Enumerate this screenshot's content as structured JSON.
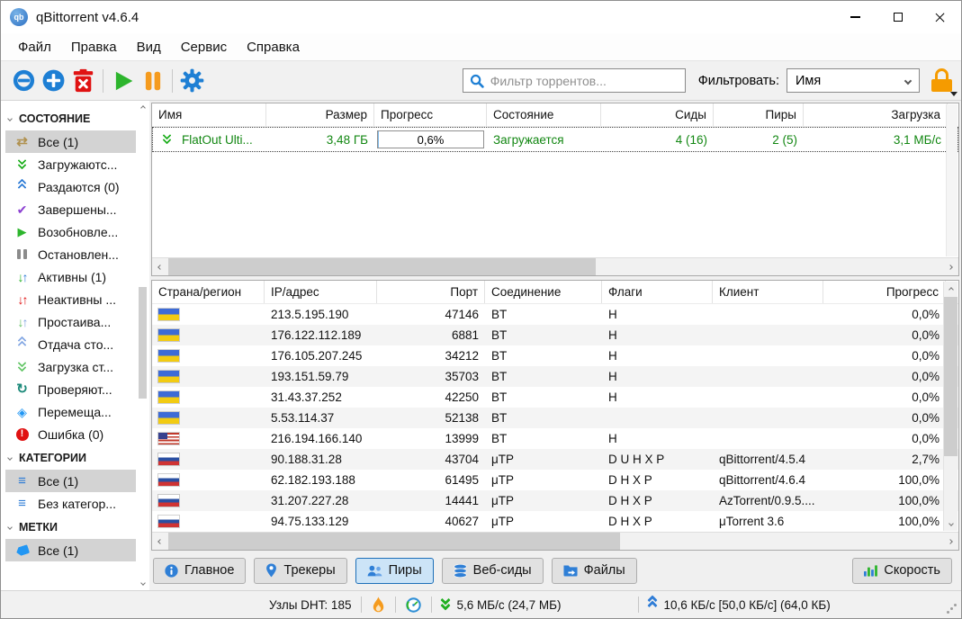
{
  "window": {
    "title": "qBittorrent v4.6.4",
    "logo_text": "qb"
  },
  "menu": {
    "items": [
      "Файл",
      "Правка",
      "Вид",
      "Сервис",
      "Справка"
    ]
  },
  "toolbar": {
    "buttons": [
      "add-link-icon",
      "add-torrent-icon",
      "delete-icon",
      "resume-icon",
      "pause-icon",
      "options-gear-icon"
    ],
    "filter_placeholder": "Фильтр торрентов...",
    "filter_label": "Фильтровать:",
    "filter_value": "Имя",
    "lock_icon": "lock-icon"
  },
  "colors": {
    "accent_blue": "#1e7fd4",
    "green": "#2db52d",
    "orange": "#f59b1e",
    "red": "#e01212",
    "torrent_text_green": "#128712",
    "tab_active_bg": "#cce4f7",
    "selected_gray": "#d3d3d3"
  },
  "sidebar": {
    "sections": [
      {
        "title": "СОСТОЯНИЕ",
        "items": [
          {
            "id": "all",
            "icon": "shuffle-icon",
            "label": "Все (1)",
            "selected": true
          },
          {
            "id": "downloading",
            "icon": "double-chevron-down-green-icon",
            "label": "Загружаютс...",
            "selected": false
          },
          {
            "id": "seeding",
            "icon": "double-chevron-up-blue-icon",
            "label": "Раздаются (0)",
            "selected": false
          },
          {
            "id": "completed",
            "icon": "checkmark-purple-icon",
            "label": "Завершены...",
            "selected": false
          },
          {
            "id": "resumed",
            "icon": "play-green-icon",
            "label": "Возобновле...",
            "selected": false
          },
          {
            "id": "stopped",
            "icon": "pause-gray-icon",
            "label": "Остановлен...",
            "selected": false
          },
          {
            "id": "active",
            "icon": "arrows-down-up-icon",
            "label": "Активны (1)",
            "selected": false
          },
          {
            "id": "inactive",
            "icon": "arrows-down-up-red-icon",
            "label": "Неактивны ...",
            "selected": false
          },
          {
            "id": "stalled",
            "icon": "arrows-down-up-light-icon",
            "label": "Простаива...",
            "selected": false
          },
          {
            "id": "stalled-uploading",
            "icon": "double-chevron-up-lightblue-icon",
            "label": "Отдача сто...",
            "selected": false
          },
          {
            "id": "stalled-downloading",
            "icon": "double-chevron-down-lightgreen-icon",
            "label": "Загрузка ст...",
            "selected": false
          },
          {
            "id": "checking",
            "icon": "refresh-teal-icon",
            "label": "Проверяют...",
            "selected": false
          },
          {
            "id": "moving",
            "icon": "move-diamond-blue-icon",
            "label": "Перемеща...",
            "selected": false
          },
          {
            "id": "errored",
            "icon": "error-red-icon",
            "label": "Ошибка (0)",
            "selected": false
          }
        ]
      },
      {
        "title": "КАТЕГОРИИ",
        "items": [
          {
            "id": "cat-all",
            "icon": "category-list-icon",
            "label": "Все (1)",
            "selected": true
          },
          {
            "id": "cat-uncategorized",
            "icon": "category-list-icon",
            "label": "Без категор...",
            "selected": false
          }
        ]
      },
      {
        "title": "МЕТКИ",
        "items": [
          {
            "id": "tag-all",
            "icon": "tag-blue-icon",
            "label": "Все (1)",
            "selected": true
          }
        ]
      }
    ]
  },
  "torrents": {
    "columns": [
      "Имя",
      "Размер",
      "Прогресс",
      "Состояние",
      "Сиды",
      "Пиры",
      "Загрузка"
    ],
    "rows": [
      {
        "name": "FlatOut Ulti...",
        "size": "3,48 ГБ",
        "progress": "0,6%",
        "state": "Загружается",
        "seeds": "4 (16)",
        "peers": "2 (5)",
        "down_speed": "3,1 МБ/с",
        "icon": "double-chevron-down-green-icon"
      }
    ]
  },
  "peers": {
    "columns": [
      "Страна/регион",
      "IP/адрес",
      "Порт",
      "Соединение",
      "Флаги",
      "Клиент",
      "Прогресс"
    ],
    "sorted_column": "Страна/регион",
    "rows": [
      {
        "flag": "ua",
        "ip": "213.5.195.190",
        "port": "47146",
        "conn": "BT",
        "flags": "H",
        "client": "",
        "progress": "0,0%"
      },
      {
        "flag": "ua",
        "ip": "176.122.112.189",
        "port": "6881",
        "conn": "BT",
        "flags": "H",
        "client": "",
        "progress": "0,0%"
      },
      {
        "flag": "ua",
        "ip": "176.105.207.245",
        "port": "34212",
        "conn": "BT",
        "flags": "H",
        "client": "",
        "progress": "0,0%"
      },
      {
        "flag": "ua",
        "ip": "193.151.59.79",
        "port": "35703",
        "conn": "BT",
        "flags": "H",
        "client": "",
        "progress": "0,0%"
      },
      {
        "flag": "ua",
        "ip": "31.43.37.252",
        "port": "42250",
        "conn": "BT",
        "flags": "H",
        "client": "",
        "progress": "0,0%"
      },
      {
        "flag": "ua",
        "ip": "5.53.114.37",
        "port": "52138",
        "conn": "BT",
        "flags": "",
        "client": "",
        "progress": "0,0%"
      },
      {
        "flag": "us",
        "ip": "216.194.166.140",
        "port": "13999",
        "conn": "BT",
        "flags": "H",
        "client": "",
        "progress": "0,0%"
      },
      {
        "flag": "ru",
        "ip": "90.188.31.28",
        "port": "43704",
        "conn": "μTP",
        "flags": "D U H X P",
        "client": "qBittorrent/4.5.4",
        "progress": "2,7%"
      },
      {
        "flag": "ru",
        "ip": "62.182.193.188",
        "port": "61495",
        "conn": "μTP",
        "flags": "D H X P",
        "client": "qBittorrent/4.6.4",
        "progress": "100,0%"
      },
      {
        "flag": "ru",
        "ip": "31.207.227.28",
        "port": "14441",
        "conn": "μTP",
        "flags": "D H X P",
        "client": "AzTorrent/0.9.5....",
        "progress": "100,0%"
      },
      {
        "flag": "ru",
        "ip": "94.75.133.129",
        "port": "40627",
        "conn": "μTP",
        "flags": "D H X P",
        "client": "μTorrent 3.6",
        "progress": "100,0%"
      }
    ]
  },
  "tabs": {
    "items": [
      {
        "id": "general",
        "icon": "info-circle-icon",
        "label": "Главное",
        "active": false
      },
      {
        "id": "trackers",
        "icon": "location-pin-icon",
        "label": "Трекеры",
        "active": false
      },
      {
        "id": "peers",
        "icon": "peers-people-icon",
        "label": "Пиры",
        "active": true
      },
      {
        "id": "webseeds",
        "icon": "stacked-discs-icon",
        "label": "Веб-сиды",
        "active": false
      },
      {
        "id": "files",
        "icon": "folder-arrow-icon",
        "label": "Файлы",
        "active": false
      }
    ],
    "speed_label": "Скорость",
    "speed_icon": "bar-chart-icon"
  },
  "statusbar": {
    "dht": "Узлы DHT: 185",
    "down_speed": "5,6 МБ/с (24,7 МБ)",
    "up_speed": "10,6 КБ/с [50,0 КБ/с] (64,0 КБ)",
    "icons": [
      "speed-limit-flame-icon",
      "alt-speed-gauge-icon",
      "download-chevrons-icon",
      "upload-chevrons-icon"
    ]
  }
}
